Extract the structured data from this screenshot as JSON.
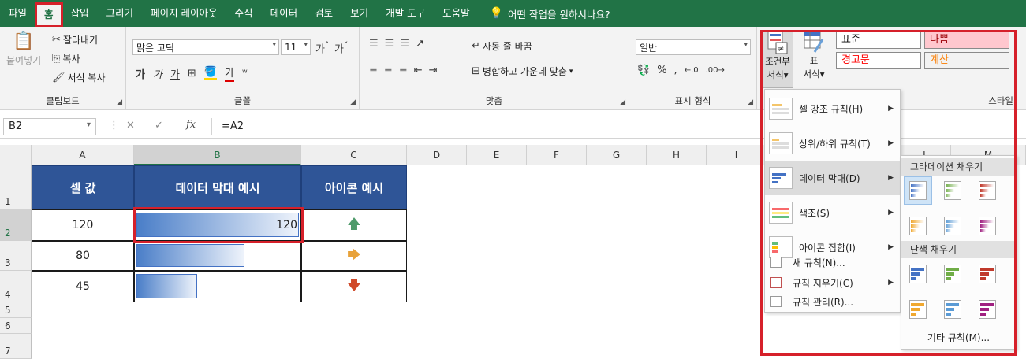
{
  "menu": {
    "tabs": [
      "파일",
      "홈",
      "삽입",
      "그리기",
      "페이지 레이아웃",
      "수식",
      "데이터",
      "검토",
      "보기",
      "개발 도구",
      "도움말"
    ],
    "active_tab": "홈",
    "tell_me": "어떤 작업을 원하시나요?"
  },
  "ribbon": {
    "clipboard": {
      "paste": "붙여넣기",
      "cut": "잘라내기",
      "copy": "복사",
      "format_painter": "서식 복사",
      "label": "클립보드"
    },
    "font": {
      "name": "맑은 고딕",
      "size": "11",
      "label": "글꼴"
    },
    "alignment": {
      "wrap": "자동 줄 바꿈",
      "merge": "병합하고 가운데 맞춤",
      "label": "맞춤"
    },
    "number": {
      "format": "일반",
      "label": "표시 형식"
    },
    "styles": {
      "conditional": "조건부",
      "conditional2": "서식",
      "table": "표",
      "table2": "서식",
      "label": "스타일",
      "cells": [
        {
          "text": "표준",
          "bg": "#ffffff",
          "fg": "#000000"
        },
        {
          "text": "나쁨",
          "bg": "#ffc7ce",
          "fg": "#9c0006"
        },
        {
          "text": "경고문",
          "bg": "#ffffff",
          "fg": "#ff0000"
        },
        {
          "text": "계산",
          "bg": "#f2f2f2",
          "fg": "#fa7d00"
        }
      ]
    }
  },
  "formula_bar": {
    "name_box": "B2",
    "formula": "=A2"
  },
  "grid": {
    "columns": [
      "A",
      "B",
      "C",
      "D",
      "E",
      "F",
      "G",
      "H",
      "I",
      "L",
      "M"
    ],
    "rows": [
      "1",
      "2",
      "3",
      "4",
      "5",
      "6",
      "7"
    ],
    "headers": [
      "셀 값",
      "데이터 막대 예시",
      "아이콘 예시"
    ],
    "data": [
      {
        "value": "120",
        "bar_fraction": 1.0,
        "bar_label": "120",
        "icon": "arrow-up-icon",
        "icon_glyph": "🡅",
        "icon_color": "#4e9a6a"
      },
      {
        "value": "80",
        "bar_fraction": 0.667,
        "bar_label": "",
        "icon": "arrow-right-icon",
        "icon_glyph": "🡆",
        "icon_color": "#e8a23a"
      },
      {
        "value": "45",
        "bar_fraction": 0.375,
        "bar_label": "",
        "icon": "arrow-down-icon",
        "icon_glyph": "🡇",
        "icon_color": "#d04a2a"
      }
    ]
  },
  "cf_menu": {
    "items": [
      {
        "label": "셀 강조 규칙(H)",
        "submenu": true
      },
      {
        "label": "상위/하위 규칙(T)",
        "submenu": true
      },
      {
        "label": "데이터 막대(D)",
        "submenu": true
      },
      {
        "label": "색조(S)",
        "submenu": true
      },
      {
        "label": "아이콘 집합(I)",
        "submenu": true
      }
    ],
    "small_items": [
      {
        "label": "새 규칙(N)...",
        "submenu": false
      },
      {
        "label": "규칙 지우기(C)",
        "submenu": true
      },
      {
        "label": "규칙 관리(R)...",
        "submenu": false
      }
    ]
  },
  "databar_submenu": {
    "gradient_label": "그라데이션 채우기",
    "solid_label": "단색 채우기",
    "more": "기타 규칙(M)...",
    "colors": [
      "#4472c4",
      "#70ad47",
      "#c0392b",
      "#f0a830",
      "#5b9bd5",
      "#a02080"
    ]
  },
  "colors": {
    "excel_green": "#217346",
    "highlight_red": "#d6202a",
    "table_header": "#2f5597"
  }
}
